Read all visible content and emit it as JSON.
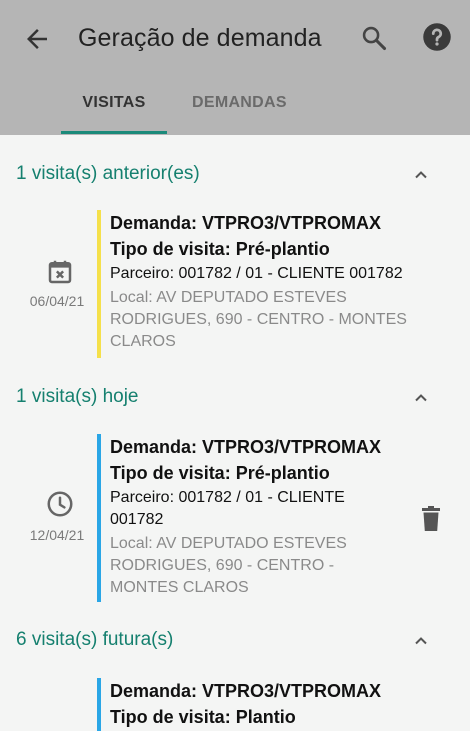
{
  "app_bar": {
    "title": "Geração de demanda",
    "back_icon": "arrow-left-icon",
    "search_icon": "search-icon",
    "help_icon": "help-circle-icon",
    "background": "#b5b5b5"
  },
  "tabs": [
    {
      "label": "VISITAS",
      "active": true
    },
    {
      "label": "DEMANDAS",
      "active": false
    }
  ],
  "accent_color": "#15806f",
  "sections": [
    {
      "label": "1 visita(s) anterior(es)",
      "expanded": true,
      "cards": [
        {
          "status_color": "#f5e04a",
          "status_icon": "calendar-cancel-icon",
          "date": "06/04/21",
          "demanda": "Demanda: VTPRO3/VTPROMAX",
          "tipo": "Tipo de visita: Pré-plantio",
          "parceiro_lines": [
            "Parceiro: 001782 / 01 - CLIENTE 001782"
          ],
          "local_lines": [
            "Local: AV DEPUTADO ESTEVES",
            "RODRIGUES, 690 - CENTRO - MONTES",
            "CLAROS"
          ],
          "deletable": false
        }
      ]
    },
    {
      "label": "1 visita(s) hoje",
      "expanded": true,
      "cards": [
        {
          "status_color": "#2aa6e6",
          "status_icon": "clock-icon",
          "date": "12/04/21",
          "demanda": "Demanda: VTPRO3/VTPROMAX",
          "tipo": "Tipo de visita: Pré-plantio",
          "parceiro_lines": [
            "Parceiro: 001782 / 01 - CLIENTE",
            "001782"
          ],
          "local_lines": [
            "Local: AV DEPUTADO ESTEVES",
            "RODRIGUES, 690 - CENTRO -",
            "MONTES CLAROS"
          ],
          "deletable": true
        }
      ]
    },
    {
      "label": "6 visita(s) futura(s)",
      "expanded": true,
      "cards": [
        {
          "status_color": "#2aa6e6",
          "demanda": "Demanda: VTPRO3/VTPROMAX",
          "tipo": "Tipo de visita: Plantio"
        }
      ]
    }
  ]
}
